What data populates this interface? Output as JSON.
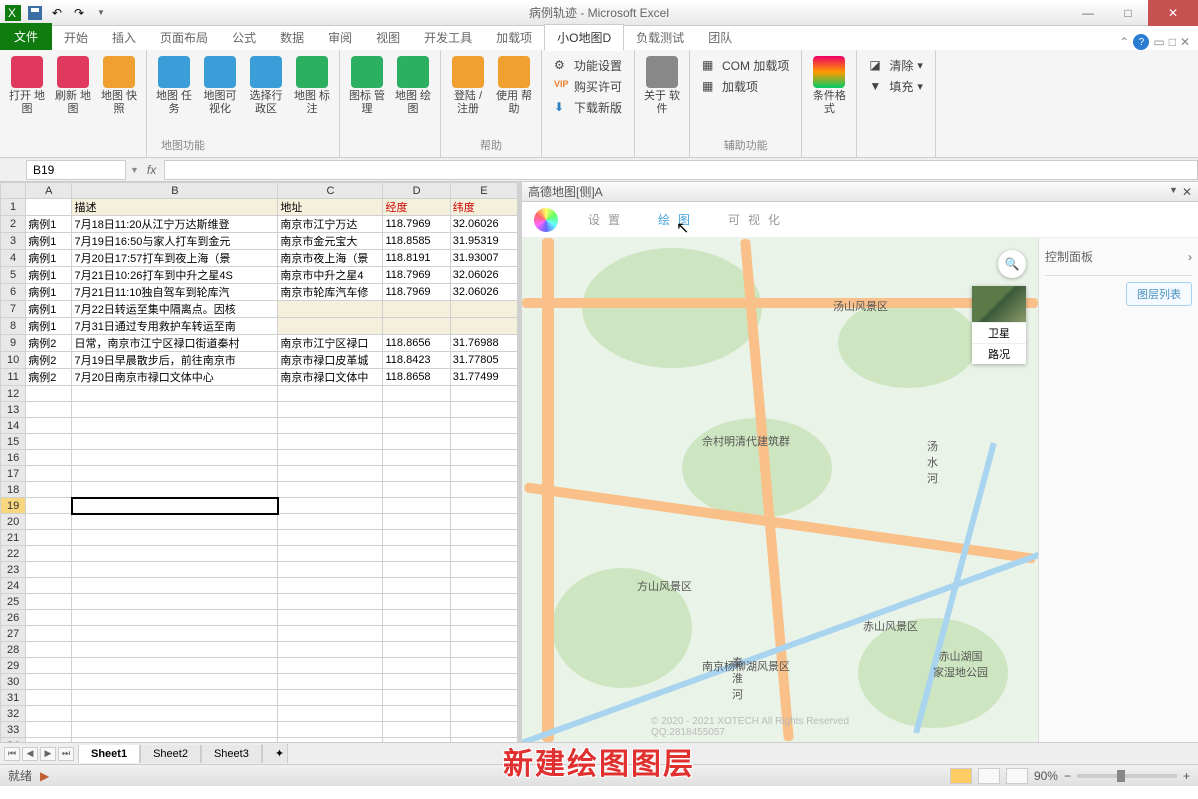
{
  "window": {
    "title": "病例轨迹 - Microsoft Excel"
  },
  "tabs": {
    "file": "文件",
    "home": "开始",
    "insert": "插入",
    "layout": "页面布局",
    "formula": "公式",
    "data": "数据",
    "review": "审阅",
    "view": "视图",
    "dev": "开发工具",
    "addin": "加载项",
    "xiaoo": "小O地图D",
    "load": "负载测试",
    "team": "团队"
  },
  "ribbon": {
    "g1": [
      "打开\n地图",
      "刷新\n地图",
      "地图\n快照"
    ],
    "g2": [
      "地图\n任务",
      "地图可\n视化",
      "选择行\n政区",
      "地图\n标注"
    ],
    "g3": [
      "图标\n管理",
      "地图\n绘图"
    ],
    "g2_lbl": "地图功能",
    "g4": [
      "登陆\n/注册",
      "使用\n帮助"
    ],
    "g5": [
      "功能设置",
      "购买许可",
      "下载新版"
    ],
    "g6": "关于\n软件",
    "g4_lbl": "帮助",
    "g7": [
      "COM 加载项",
      "加载项"
    ],
    "g8": "条件格式",
    "g9": [
      "清除",
      "填充"
    ],
    "g7_lbl": "辅助功能"
  },
  "namebox": "B19",
  "cols": [
    "A",
    "B",
    "C",
    "D",
    "E"
  ],
  "hdr": {
    "B": "描述",
    "C": "地址",
    "D": "经度",
    "E": "纬度"
  },
  "rows": [
    {
      "r": 2,
      "A": "病例1",
      "B": "7月18日11:20从江宁万达斯维登",
      "C": "南京市江宁万达",
      "D": "118.7969",
      "E": "32.06026"
    },
    {
      "r": 3,
      "A": "病例1",
      "B": "7月19日16:50与家人打车到金元",
      "C": "南京市金元宝大",
      "D": "118.8585",
      "E": "31.95319"
    },
    {
      "r": 4,
      "A": "病例1",
      "B": "7月20日17:57打车到夜上海（景",
      "C": "南京市夜上海（景",
      "D": "118.8191",
      "E": "31.93007"
    },
    {
      "r": 5,
      "A": "病例1",
      "B": "7月21日10:26打车到中升之星4S",
      "C": "南京市中升之星4",
      "D": "118.7969",
      "E": "32.06026"
    },
    {
      "r": 6,
      "A": "病例1",
      "B": "7月21日11:10独自驾车到轮库汽",
      "C": "南京市轮库汽车修",
      "D": "118.7969",
      "E": "32.06026"
    },
    {
      "r": 7,
      "A": "病例1",
      "B": "7月22日转运至集中隔离点。因核",
      "C": "",
      "D": "",
      "E": ""
    },
    {
      "r": 8,
      "A": "病例1",
      "B": "7月31日通过专用救护车转运至南",
      "C": "",
      "D": "",
      "E": ""
    },
    {
      "r": 9,
      "A": "病例2",
      "B": "日常，南京市江宁区禄口街道秦村",
      "C": "南京市江宁区禄口",
      "D": "118.8656",
      "E": "31.76988"
    },
    {
      "r": 10,
      "A": "病例2",
      "B": "7月19日早晨散步后，前往南京市",
      "C": "南京市禄口皮革城",
      "D": "118.8423",
      "E": "31.77805"
    },
    {
      "r": 11,
      "A": "病例2",
      "B": "7月20日南京市禄口文体中心",
      "C": "南京市禄口文体中",
      "D": "118.8658",
      "E": "31.77499"
    }
  ],
  "map": {
    "title": "高德地图[侧]A",
    "tabs": {
      "settings": "设置",
      "draw": "绘图",
      "viz": "可视化"
    },
    "labels": {
      "tangshan": "汤山风景区",
      "tanghe": "汤\n水\n河",
      "yucun": "佘村明清代建筑群",
      "fangshan": "方山风景区",
      "yangliu": "南京杨柳湖风景区",
      "chishan": "赤山风景区",
      "chihu": "赤山湖国\n家湿地公园",
      "qinhe": "秦\n淮\n河"
    },
    "copyright": "© 2020 - 2021 XOTECH All Rights Reserved QQ:2818455057",
    "layer": {
      "sat": "卫星",
      "traffic": "路况"
    }
  },
  "side": {
    "hdr": "控制面板",
    "btn": "图层列表"
  },
  "sheets": [
    "Sheet1",
    "Sheet2",
    "Sheet3"
  ],
  "status": {
    "ready": "就绪",
    "zoom": "90%"
  },
  "overlay": "新建绘图图层"
}
